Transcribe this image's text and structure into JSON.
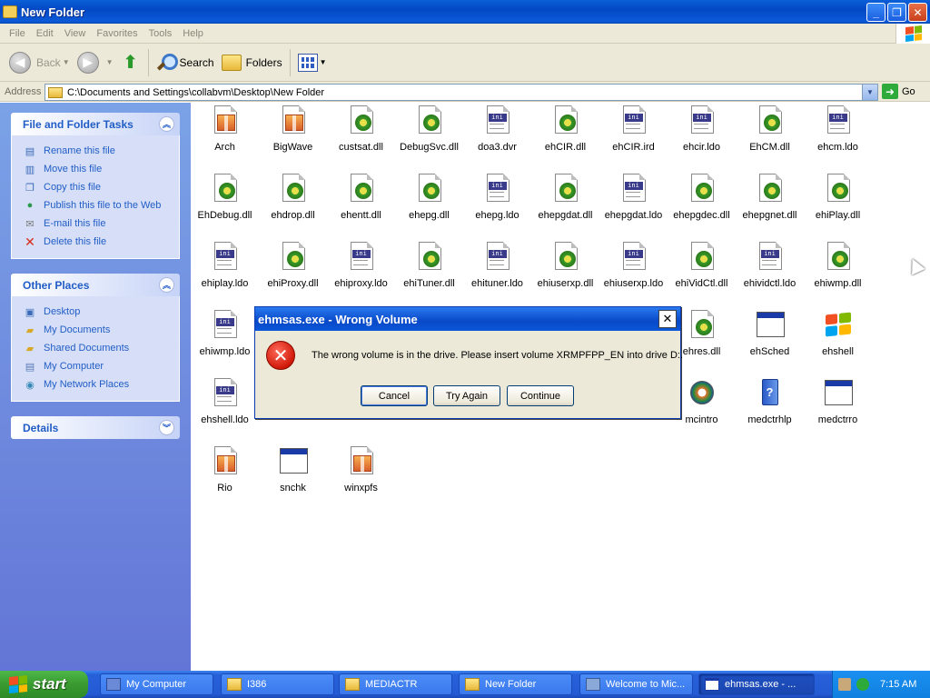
{
  "window": {
    "title": "New Folder"
  },
  "menu": [
    "File",
    "Edit",
    "View",
    "Favorites",
    "Tools",
    "Help"
  ],
  "toolbar": {
    "back": "Back",
    "search": "Search",
    "folders": "Folders"
  },
  "address": {
    "label": "Address",
    "path": "C:\\Documents and Settings\\collabvm\\Desktop\\New Folder",
    "go": "Go"
  },
  "tasks": {
    "title": "File and Folder Tasks",
    "items": [
      {
        "label": "Rename this file",
        "icon": "rename-icon"
      },
      {
        "label": "Move this file",
        "icon": "move-icon"
      },
      {
        "label": "Copy this file",
        "icon": "copy-icon"
      },
      {
        "label": "Publish this file to the Web",
        "icon": "globe-icon"
      },
      {
        "label": "E-mail this file",
        "icon": "email-icon"
      },
      {
        "label": "Delete this file",
        "icon": "delete-icon"
      }
    ]
  },
  "places": {
    "title": "Other Places",
    "items": [
      {
        "label": "Desktop",
        "icon": "desktop-icon"
      },
      {
        "label": "My Documents",
        "icon": "my-documents-icon"
      },
      {
        "label": "Shared Documents",
        "icon": "shared-documents-icon"
      },
      {
        "label": "My Computer",
        "icon": "my-computer-icon"
      },
      {
        "label": "My Network Places",
        "icon": "network-places-icon"
      }
    ]
  },
  "details": {
    "title": "Details"
  },
  "files": [
    {
      "name": "Arch",
      "icon": "package"
    },
    {
      "name": "BigWave",
      "icon": "package"
    },
    {
      "name": "custsat.dll",
      "icon": "dll"
    },
    {
      "name": "DebugSvc.dll",
      "icon": "dll"
    },
    {
      "name": "doa3.dvr",
      "icon": "ini"
    },
    {
      "name": "ehCIR.dll",
      "icon": "dll"
    },
    {
      "name": "ehCIR.ird",
      "icon": "ini"
    },
    {
      "name": "ehcir.ldo",
      "icon": "ini"
    },
    {
      "name": "EhCM.dll",
      "icon": "dll"
    },
    {
      "name": "ehcm.ldo",
      "icon": "ini"
    },
    {
      "name": "EhDebug.dll",
      "icon": "dll"
    },
    {
      "name": "ehdrop.dll",
      "icon": "dll"
    },
    {
      "name": "ehentt.dll",
      "icon": "dll"
    },
    {
      "name": "ehepg.dll",
      "icon": "dll"
    },
    {
      "name": "ehepg.ldo",
      "icon": "ini"
    },
    {
      "name": "ehepgdat.dll",
      "icon": "dll"
    },
    {
      "name": "ehepgdat.ldo",
      "icon": "ini"
    },
    {
      "name": "ehepgdec.dll",
      "icon": "dll"
    },
    {
      "name": "ehepgnet.dll",
      "icon": "dll"
    },
    {
      "name": "ehiPlay.dll",
      "icon": "dll"
    },
    {
      "name": "ehiplay.ldo",
      "icon": "ini"
    },
    {
      "name": "ehiProxy.dll",
      "icon": "dll"
    },
    {
      "name": "ehiproxy.ldo",
      "icon": "ini"
    },
    {
      "name": "ehiTuner.dll",
      "icon": "dll"
    },
    {
      "name": "ehituner.ldo",
      "icon": "ini"
    },
    {
      "name": "ehiuserxp.dll",
      "icon": "dll"
    },
    {
      "name": "ehiuserxp.ldo",
      "icon": "ini"
    },
    {
      "name": "ehiVidCtl.dll",
      "icon": "dll"
    },
    {
      "name": "ehividctl.ldo",
      "icon": "ini"
    },
    {
      "name": "ehiwmp.dll",
      "icon": "dll"
    },
    {
      "name": "ehiwmp.ldo",
      "icon": "ini"
    },
    {
      "name": "ehres.dll",
      "icon": "dll"
    },
    {
      "name": "ehSched",
      "icon": "window"
    },
    {
      "name": "ehshell",
      "icon": "winlogo"
    },
    {
      "name": "ehshell.ldo",
      "icon": "ini"
    },
    {
      "name": "mcintro",
      "icon": "media"
    },
    {
      "name": "medctrhlp",
      "icon": "help"
    },
    {
      "name": "medctrro",
      "icon": "window"
    },
    {
      "name": "Rio",
      "icon": "package"
    },
    {
      "name": "snchk",
      "icon": "window"
    },
    {
      "name": "winxpfs",
      "icon": "package"
    }
  ],
  "dialog": {
    "title": "ehmsas.exe - Wrong Volume",
    "message": "The wrong volume is in the drive. Please insert volume XRMPFPP_EN into drive D:.",
    "buttons": [
      "Cancel",
      "Try Again",
      "Continue"
    ]
  },
  "taskbar": {
    "start": "start",
    "tasks": [
      {
        "label": "My Computer",
        "icon": "my-computer-icon"
      },
      {
        "label": "I386",
        "icon": "folder-icon"
      },
      {
        "label": "MEDIACTR",
        "icon": "folder-icon"
      },
      {
        "label": "New Folder",
        "icon": "folder-icon"
      },
      {
        "label": "Welcome to Mic...",
        "icon": "setup-icon"
      },
      {
        "label": "ehmsas.exe - ...",
        "icon": "window-icon"
      }
    ],
    "clock": "7:15 AM"
  }
}
